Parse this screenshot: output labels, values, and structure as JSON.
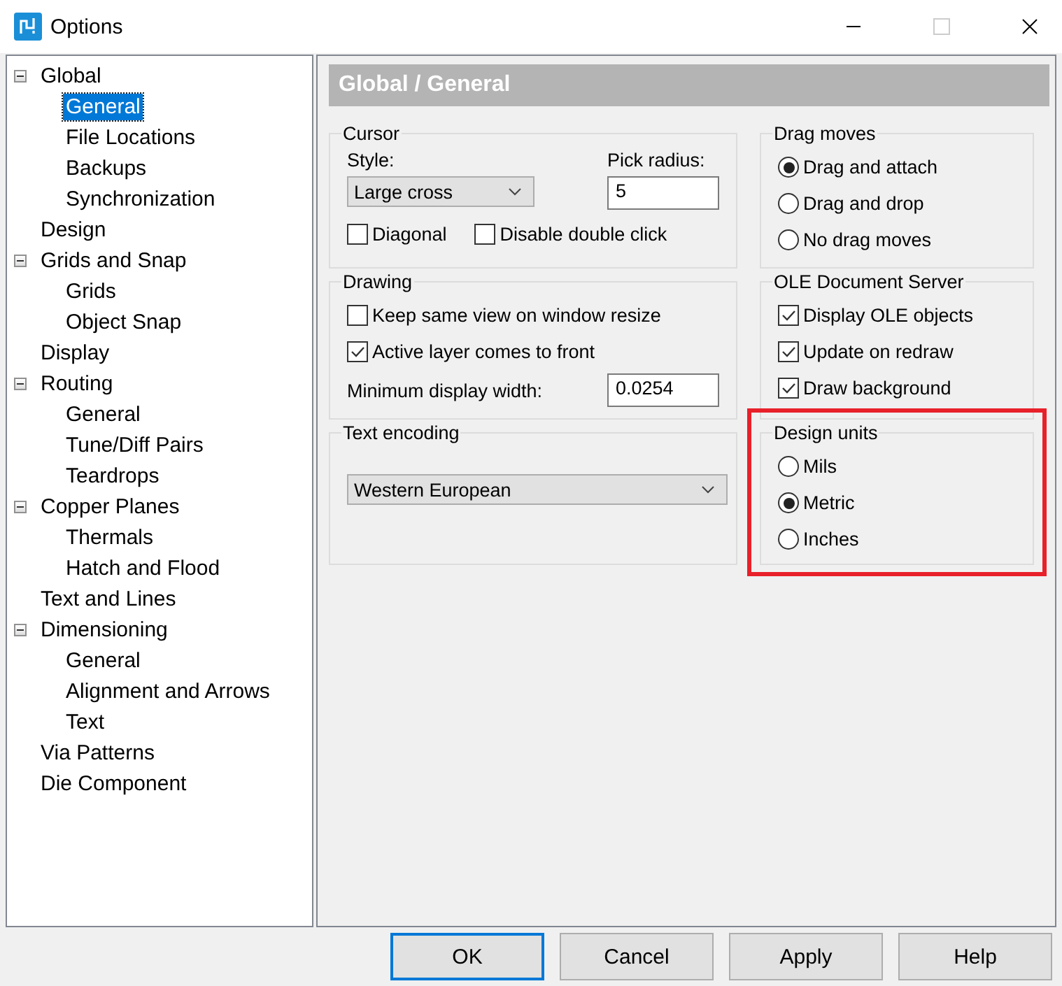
{
  "window": {
    "title": "Options"
  },
  "tree": [
    {
      "label": "Global",
      "expanded": true,
      "selected": false,
      "children": [
        {
          "label": "General",
          "selected": true
        },
        {
          "label": "File Locations",
          "selected": false
        },
        {
          "label": "Backups",
          "selected": false
        },
        {
          "label": "Synchronization",
          "selected": false
        }
      ]
    },
    {
      "label": "Design",
      "selected": false
    },
    {
      "label": "Grids and Snap",
      "expanded": true,
      "selected": false,
      "children": [
        {
          "label": "Grids",
          "selected": false
        },
        {
          "label": "Object Snap",
          "selected": false
        }
      ]
    },
    {
      "label": "Display",
      "selected": false
    },
    {
      "label": "Routing",
      "expanded": true,
      "selected": false,
      "children": [
        {
          "label": "General",
          "selected": false
        },
        {
          "label": "Tune/Diff Pairs",
          "selected": false
        },
        {
          "label": "Teardrops",
          "selected": false
        }
      ]
    },
    {
      "label": "Copper Planes",
      "expanded": true,
      "selected": false,
      "children": [
        {
          "label": "Thermals",
          "selected": false
        },
        {
          "label": "Hatch and Flood",
          "selected": false
        }
      ]
    },
    {
      "label": "Text and Lines",
      "selected": false
    },
    {
      "label": "Dimensioning",
      "expanded": true,
      "selected": false,
      "children": [
        {
          "label": "General",
          "selected": false
        },
        {
          "label": "Alignment and Arrows",
          "selected": false
        },
        {
          "label": "Text",
          "selected": false
        }
      ]
    },
    {
      "label": "Via Patterns",
      "selected": false
    },
    {
      "label": "Die Component",
      "selected": false
    }
  ],
  "page_header": "Global / General",
  "cursor": {
    "title": "Cursor",
    "style_label": "Style:",
    "style_value": "Large cross",
    "pick_radius_label": "Pick radius:",
    "pick_radius_value": "5",
    "options": [
      {
        "label": "Diagonal",
        "checked": false
      },
      {
        "label": "Disable double click",
        "checked": false
      }
    ]
  },
  "drawing": {
    "title": "Drawing",
    "options": [
      {
        "label": "Keep same view on window resize",
        "checked": false
      },
      {
        "label": "Active layer comes to front",
        "checked": true
      }
    ],
    "min_width_label": "Minimum display width:",
    "min_width_value": "0.0254"
  },
  "text_encoding": {
    "title": "Text encoding",
    "value": "Western European"
  },
  "drag_moves": {
    "title": "Drag moves",
    "options": [
      {
        "label": "Drag and attach",
        "selected": true
      },
      {
        "label": "Drag and drop",
        "selected": false
      },
      {
        "label": "No drag moves",
        "selected": false
      }
    ]
  },
  "ole_server": {
    "title": "OLE Document Server",
    "options": [
      {
        "label": "Display OLE objects",
        "checked": true
      },
      {
        "label": "Update on redraw",
        "checked": true
      },
      {
        "label": "Draw background",
        "checked": true
      }
    ]
  },
  "design_units": {
    "title": "Design units",
    "highlighted": true,
    "options": [
      {
        "label": "Mils",
        "selected": false
      },
      {
        "label": "Metric",
        "selected": true
      },
      {
        "label": "Inches",
        "selected": false
      }
    ]
  },
  "buttons": [
    {
      "label": "OK",
      "default": true
    },
    {
      "label": "Cancel",
      "default": false
    },
    {
      "label": "Apply",
      "default": false
    },
    {
      "label": "Help",
      "default": false
    }
  ]
}
